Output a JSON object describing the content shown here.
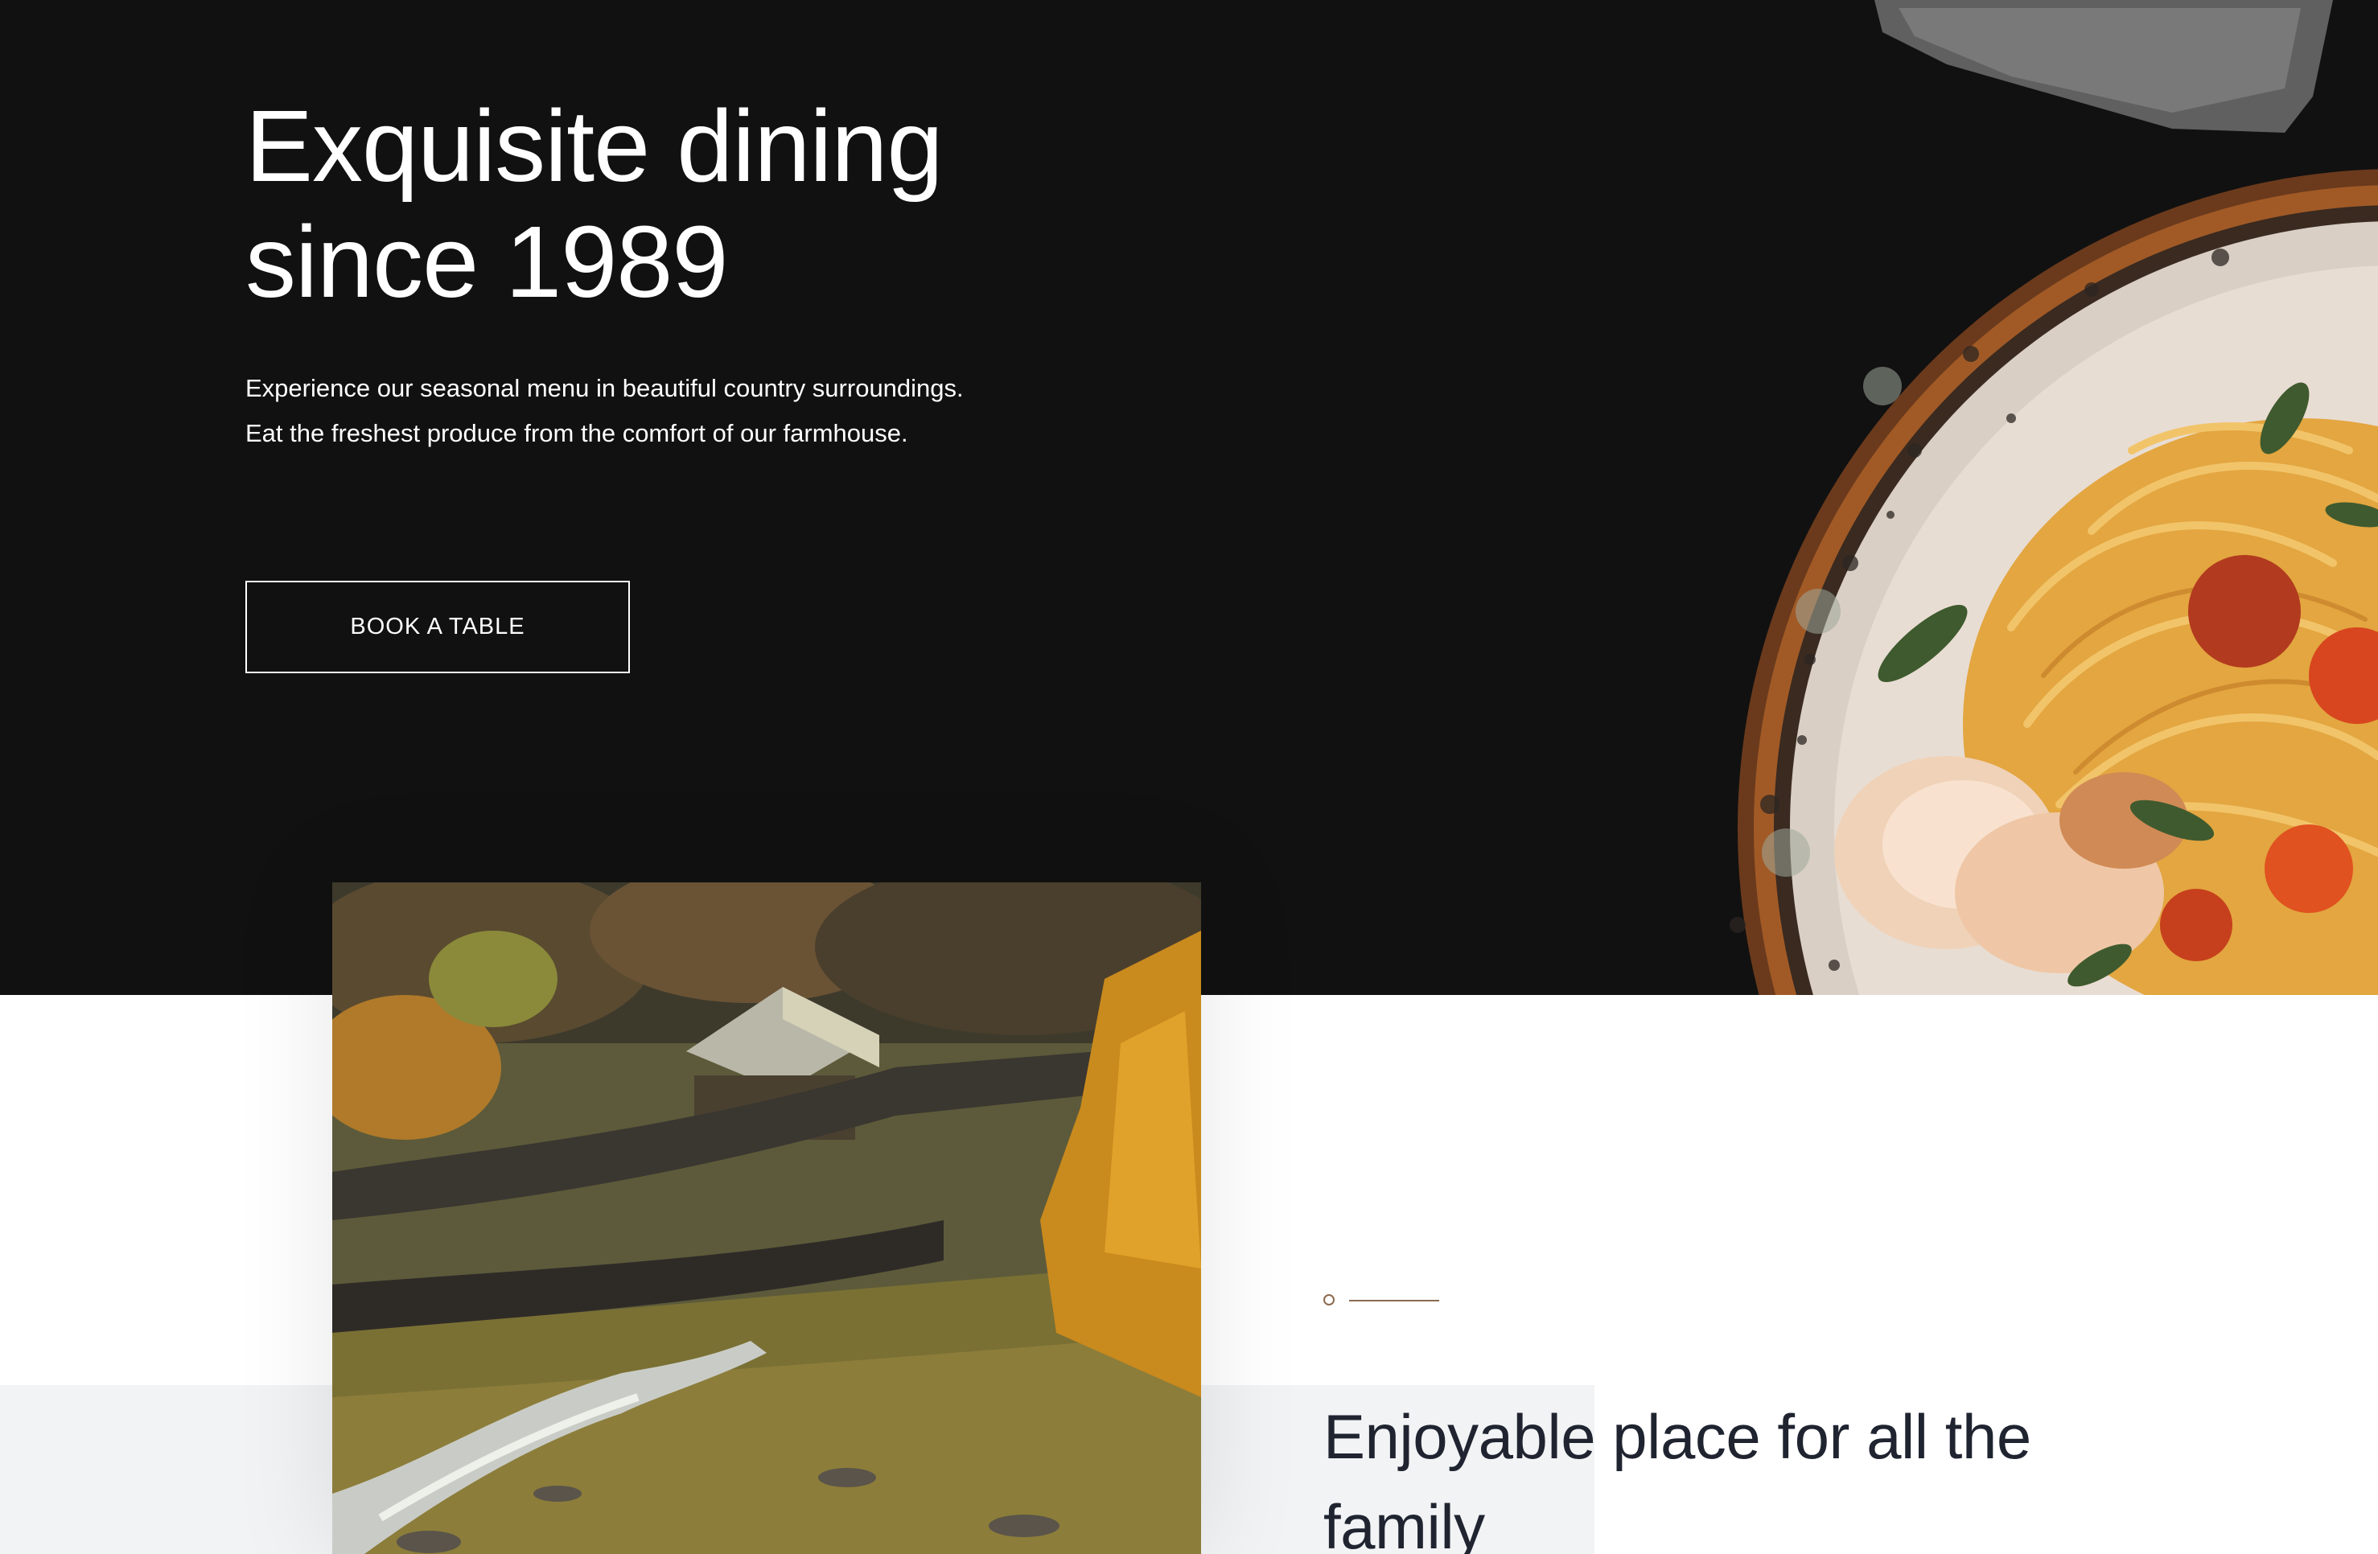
{
  "hero": {
    "title": "Exquisite dining\nsince 1989",
    "description": "Experience our seasonal menu in beautiful country surroundings. Eat the freshest produce from the comfort of our farmhouse.",
    "cta_label": "BOOK A TABLE",
    "background_color": "#111111",
    "image_icon": "pasta-dish-image"
  },
  "about": {
    "title": "Enjoyable place for all the family",
    "image_icon": "countryside-landscape-image",
    "accent_color": "#8b6a4f"
  }
}
